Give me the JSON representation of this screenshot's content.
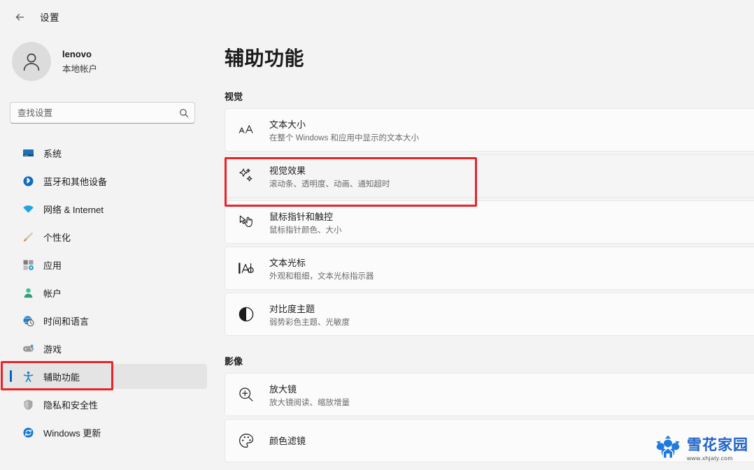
{
  "titlebar": {
    "back_icon": "back-arrow-icon",
    "title": "设置"
  },
  "sidebar": {
    "account": {
      "avatar_icon": "user-avatar-icon",
      "name": "lenovo",
      "type": "本地帐户"
    },
    "search": {
      "placeholder": "查找设置",
      "value": "",
      "icon": "search-icon"
    },
    "items": [
      {
        "label": "系统",
        "icon": "system-monitor-icon",
        "selected": false
      },
      {
        "label": "蓝牙和其他设备",
        "icon": "bluetooth-icon",
        "selected": false
      },
      {
        "label": "网络 & Internet",
        "icon": "wifi-icon",
        "selected": false
      },
      {
        "label": "个性化",
        "icon": "paintbrush-icon",
        "selected": false
      },
      {
        "label": "应用",
        "icon": "apps-grid-icon",
        "selected": false
      },
      {
        "label": "帐户",
        "icon": "account-person-icon",
        "selected": false
      },
      {
        "label": "时间和语言",
        "icon": "clock-globe-icon",
        "selected": false
      },
      {
        "label": "游戏",
        "icon": "gamepad-icon",
        "selected": false
      },
      {
        "label": "辅助功能",
        "icon": "accessibility-person-icon",
        "selected": true
      },
      {
        "label": "隐私和安全性",
        "icon": "shield-icon",
        "selected": false
      },
      {
        "label": "Windows 更新",
        "icon": "update-refresh-icon",
        "selected": false
      }
    ]
  },
  "main": {
    "page_title": "辅助功能",
    "sections": [
      {
        "heading": "视觉",
        "cards": [
          {
            "icon": "text-size-aa-icon",
            "title": "文本大小",
            "subtitle": "在整个 Windows 和应用中显示的文本大小",
            "highlighted": false
          },
          {
            "icon": "sparkles-icon",
            "title": "视觉效果",
            "subtitle": "滚动条、透明度、动画、通知超时",
            "highlighted": true
          },
          {
            "icon": "mouse-pointer-touch-icon",
            "title": "鼠标指针和触控",
            "subtitle": "鼠标指针颜色、大小",
            "highlighted": false
          },
          {
            "icon": "text-cursor-icon",
            "title": "文本光标",
            "subtitle": "外观和粗细，文本光标指示器",
            "highlighted": false
          },
          {
            "icon": "contrast-circle-icon",
            "title": "对比度主题",
            "subtitle": "弱势彩色主题、光敏度",
            "highlighted": false
          }
        ]
      },
      {
        "heading": "影像",
        "cards": [
          {
            "icon": "magnifier-plus-icon",
            "title": "放大镜",
            "subtitle": "放大镜阅读、缩放增量",
            "highlighted": false
          },
          {
            "icon": "color-filter-palette-icon",
            "title": "颜色滤镜",
            "subtitle": "",
            "highlighted": false
          }
        ]
      }
    ]
  },
  "annotations": {
    "accent_color": "#e8232a",
    "sidebar_target": "辅助功能",
    "card_target": "视觉效果"
  },
  "watermark": {
    "logo_icon": "snowflake-house-logo-icon",
    "title": "雪花家园",
    "url": "www.xhjaty.com",
    "color": "#1f63c8"
  },
  "theme": {
    "selection_accent": "#0067c0",
    "page_background": "#f3f3f3",
    "card_background": "#fbfbfb"
  }
}
